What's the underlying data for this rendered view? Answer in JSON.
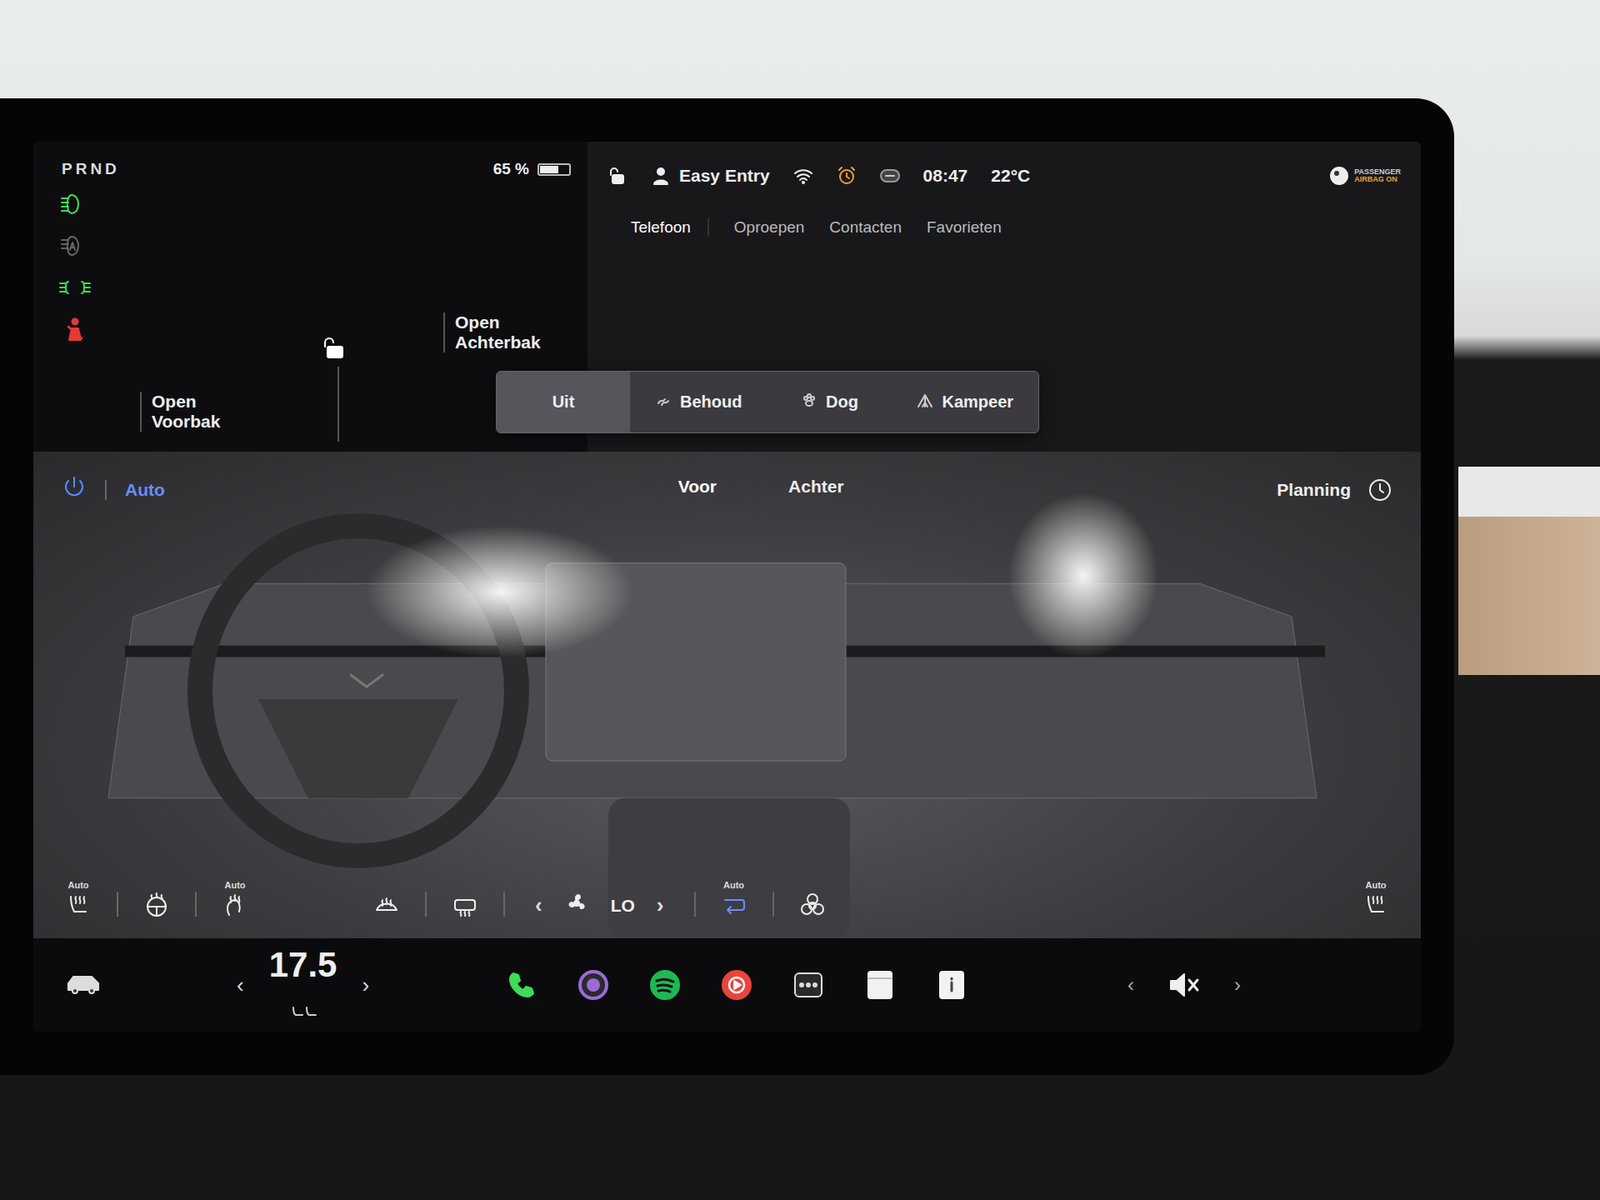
{
  "gear": "PRND",
  "indicators": [
    {
      "kind": "lowbeam",
      "on": true,
      "color": "#3ddc5a"
    },
    {
      "kind": "autohigh",
      "on": false,
      "color": "#8a8a8a"
    },
    {
      "kind": "parking",
      "on": true,
      "color": "#3ddc5a"
    },
    {
      "kind": "seatbelt",
      "on": true,
      "color": "#e53935"
    }
  ],
  "status": {
    "battery": "65 %",
    "battery_level": 0.65,
    "profile": "Easy Entry",
    "time": "08:47",
    "temperature": "22°C",
    "airbag_line1": "PASSENGER",
    "airbag_line2": "AIRBAG ON",
    "locked": false
  },
  "car": {
    "frunk": "Open Voorbak",
    "trunk": "Open Achterbak",
    "locked": false
  },
  "phone": {
    "title": "Telefoon",
    "tabs": [
      "Oproepen",
      "Contacten",
      "Favorieten"
    ]
  },
  "climate_modes": [
    {
      "label": "Uit",
      "kind": "off",
      "selected": true
    },
    {
      "label": "Behoud",
      "kind": "keep",
      "selected": false
    },
    {
      "label": "Dog",
      "kind": "dog",
      "selected": false
    },
    {
      "label": "Kampeer",
      "kind": "camp",
      "selected": false
    }
  ],
  "climate": {
    "on": true,
    "auto": "Auto",
    "tabs": [
      {
        "label": "Voor",
        "selected": true
      },
      {
        "label": "Achter",
        "selected": false
      }
    ],
    "planning": "Planning"
  },
  "controls_left": [
    {
      "kind": "seatheat",
      "label": "Auto",
      "on": true
    },
    {
      "kind": "wheelheat",
      "label": "",
      "on": false
    },
    {
      "kind": "seatheat2",
      "label": "Auto",
      "on": true
    },
    {
      "kind": "defrost",
      "label": "",
      "on": false
    },
    {
      "kind": "reardefrost",
      "label": "",
      "on": false
    }
  ],
  "fan": {
    "prev": "‹",
    "value": "LO",
    "next": "›"
  },
  "controls_right": [
    {
      "kind": "recirc",
      "label": "Auto",
      "on": true
    },
    {
      "kind": "bio",
      "label": "",
      "on": false
    }
  ],
  "control_far_right": {
    "kind": "seatheat",
    "label": "Auto",
    "on": true
  },
  "dock": {
    "temp_prev": "‹",
    "temperature": "17.5",
    "temp_next": "›",
    "apps": [
      {
        "kind": "phone",
        "color": "#3ddc5a"
      },
      {
        "kind": "camera",
        "color": "#9b6bd6"
      },
      {
        "kind": "spotify",
        "color": "#1db954"
      },
      {
        "kind": "music",
        "color": "#e8453c"
      },
      {
        "kind": "more",
        "color": "#dddddd"
      },
      {
        "kind": "notes",
        "color": "#f2f2f2"
      },
      {
        "kind": "manual",
        "color": "#f2f2f2"
      }
    ],
    "volume_prev": "‹",
    "muted": true,
    "volume_next": "›"
  }
}
